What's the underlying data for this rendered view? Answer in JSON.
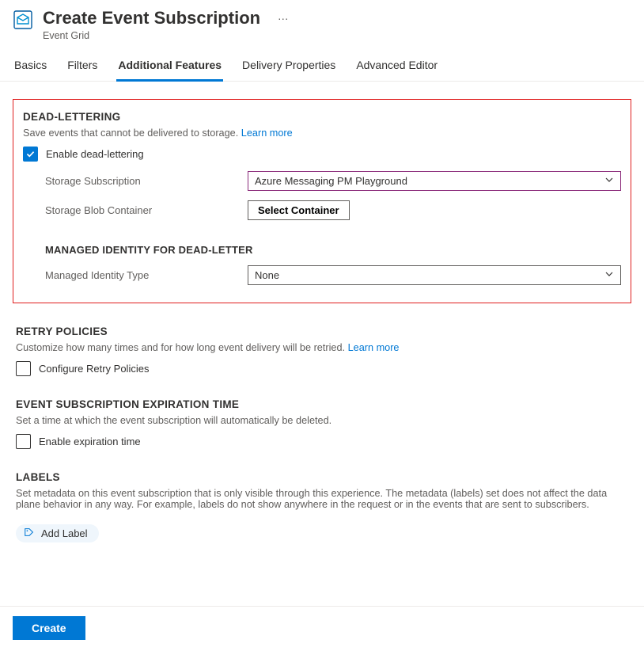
{
  "header": {
    "title": "Create Event Subscription",
    "subtitle": "Event Grid",
    "more": "…"
  },
  "tabs": [
    {
      "label": "Basics",
      "active": false
    },
    {
      "label": "Filters",
      "active": false
    },
    {
      "label": "Additional Features",
      "active": true
    },
    {
      "label": "Delivery Properties",
      "active": false
    },
    {
      "label": "Advanced Editor",
      "active": false
    }
  ],
  "deadLettering": {
    "heading": "DEAD-LETTERING",
    "desc": "Save events that cannot be delivered to storage.",
    "learnMore": "Learn more",
    "enableLabel": "Enable dead-lettering",
    "enableChecked": true,
    "storageSubLabel": "Storage Subscription",
    "storageSubValue": "Azure Messaging PM Playground",
    "storageBlobLabel": "Storage Blob Container",
    "selectContainer": "Select Container",
    "miHeading": "MANAGED IDENTITY FOR DEAD-LETTER",
    "miTypeLabel": "Managed Identity Type",
    "miTypeValue": "None"
  },
  "retry": {
    "heading": "RETRY POLICIES",
    "desc": "Customize how many times and for how long event delivery will be retried.",
    "learnMore": "Learn more",
    "configureLabel": "Configure Retry Policies",
    "configureChecked": false
  },
  "expiration": {
    "heading": "EVENT SUBSCRIPTION EXPIRATION TIME",
    "desc": "Set a time at which the event subscription will automatically be deleted.",
    "enableLabel": "Enable expiration time",
    "enableChecked": false
  },
  "labels": {
    "heading": "LABELS",
    "desc": "Set metadata on this event subscription that is only visible through this experience. The metadata (labels) set does not affect the data plane behavior in any way. For example, labels do not show anywhere in the request or in the events that are sent to subscribers.",
    "addLabel": "Add Label"
  },
  "footer": {
    "create": "Create"
  }
}
